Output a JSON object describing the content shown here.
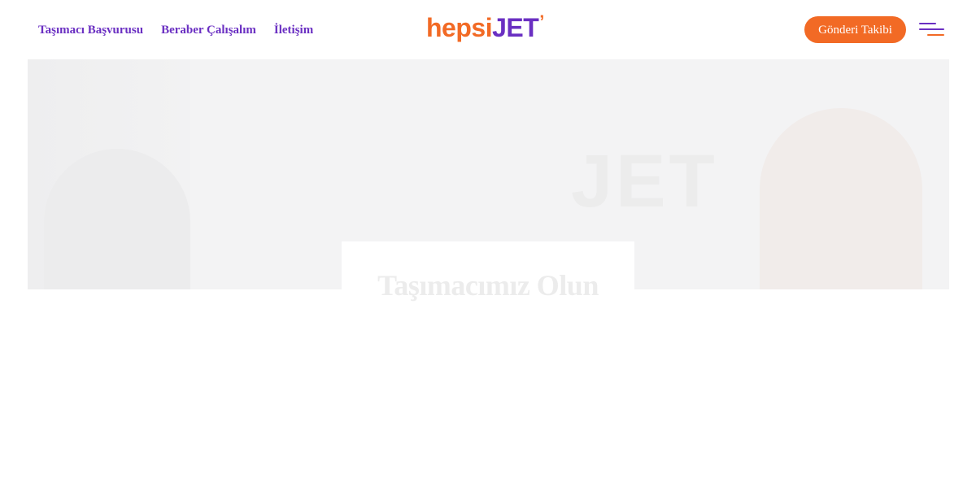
{
  "nav": {
    "items": [
      {
        "label": "Taşımacı Başvurusu"
      },
      {
        "label": "Beraber Çalışalım"
      },
      {
        "label": "İletişim"
      }
    ]
  },
  "logo": {
    "part1": "hepsi",
    "part2": "JET",
    "tick": "ʼ"
  },
  "header": {
    "track_label": "Gönderi Takibi",
    "menu_icon": "hamburger-menu-icon"
  },
  "hero": {
    "van_text": "JET"
  },
  "title_card": {
    "title": "Taşımacımız Olun",
    "subtitle": ""
  },
  "colors": {
    "accent_purple": "#6a2fc2",
    "accent_orange": "#f26a25"
  }
}
